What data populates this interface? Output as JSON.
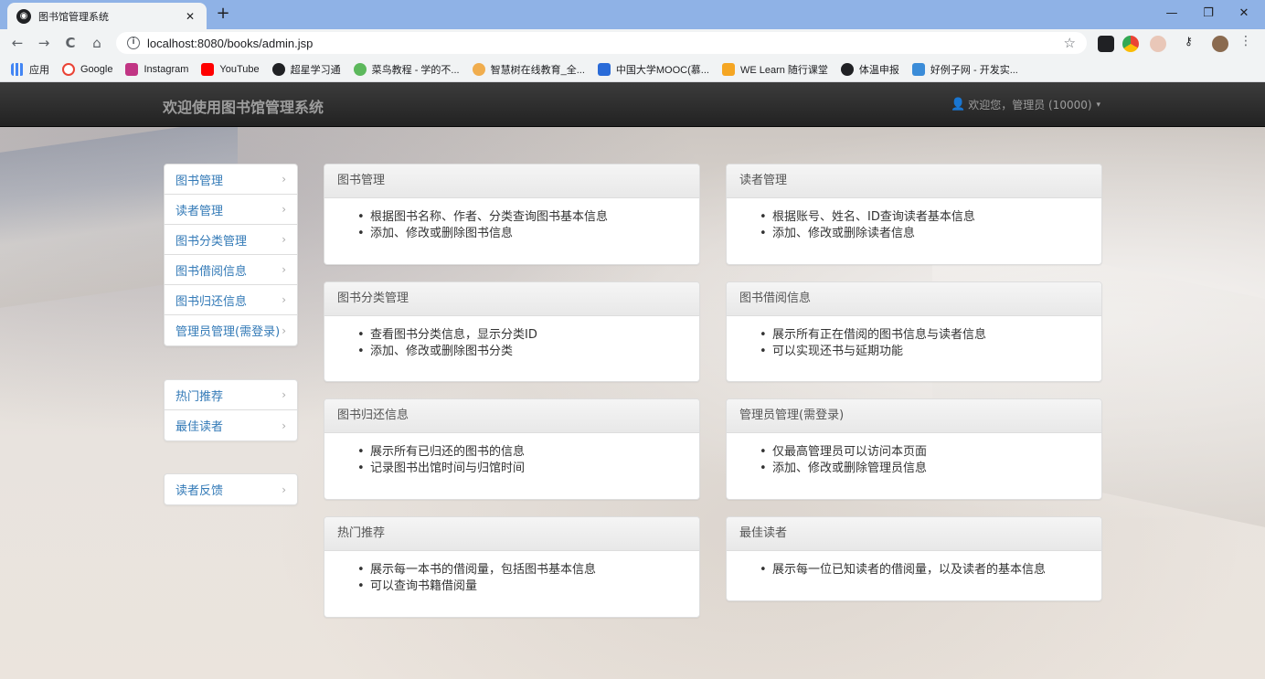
{
  "browser": {
    "tab_title": "图书馆管理系统",
    "tab_close": "✕",
    "new_tab": "+",
    "url": "localhost:8080/books/admin.jsp",
    "back": "←",
    "forward": "→",
    "reload": "C",
    "home": "⌂",
    "star": "☆",
    "window": {
      "minimize": "—",
      "maximize": "❐",
      "close": "✕"
    },
    "bookmarks": [
      {
        "label": "应用",
        "color": "#4285f4"
      },
      {
        "label": "Google",
        "color": "#ea4335"
      },
      {
        "label": "Instagram",
        "color": "#c13584"
      },
      {
        "label": "YouTube",
        "color": "#ff0000"
      },
      {
        "label": "超星学习通",
        "color": "#202124"
      },
      {
        "label": "菜鸟教程 - 学的不...",
        "color": "#5cb85c"
      },
      {
        "label": "智慧树在线教育_全...",
        "color": "#f0ad4e"
      },
      {
        "label": "中国大学MOOC(慕...",
        "color": "#2a6bd8"
      },
      {
        "label": "WE Learn 随行课堂",
        "color": "#f5a623"
      },
      {
        "label": "体温申报",
        "color": "#202124"
      },
      {
        "label": "好例子网 - 开发实...",
        "color": "#3b8cd8"
      }
    ]
  },
  "app": {
    "brand": "欢迎使用图书馆管理系统",
    "user": "欢迎您，管理员 (10000)",
    "user_icon": "👤",
    "caret": "▾"
  },
  "sidebar": {
    "chevron": "›",
    "group1": [
      "图书管理",
      "读者管理",
      "图书分类管理",
      "图书借阅信息",
      "图书归还信息",
      "管理员管理(需登录)"
    ],
    "group2": [
      "热门推荐",
      "最佳读者"
    ],
    "group3": [
      "读者反馈"
    ]
  },
  "panels": [
    {
      "title": "图书管理",
      "items": [
        "根据图书名称、作者、分类查询图书基本信息",
        "添加、修改或删除图书信息"
      ]
    },
    {
      "title": "读者管理",
      "items": [
        "根据账号、姓名、ID查询读者基本信息",
        "添加、修改或删除读者信息"
      ]
    },
    {
      "title": "图书分类管理",
      "items": [
        "查看图书分类信息，显示分类ID",
        "添加、修改或删除图书分类"
      ]
    },
    {
      "title": "图书借阅信息",
      "items": [
        "展示所有正在借阅的图书信息与读者信息",
        "可以实现还书与延期功能"
      ]
    },
    {
      "title": "图书归还信息",
      "items": [
        "展示所有已归还的图书的信息",
        "记录图书出馆时间与归馆时间"
      ]
    },
    {
      "title": "管理员管理(需登录)",
      "items": [
        "仅最高管理员可以访问本页面",
        "添加、修改或删除管理员信息"
      ]
    },
    {
      "title": "热门推荐",
      "items": [
        "展示每一本书的借阅量，包括图书基本信息",
        "可以查询书籍借阅量"
      ]
    },
    {
      "title": "最佳读者",
      "items": [
        "展示每一位已知读者的借阅量，以及读者的基本信息"
      ]
    }
  ]
}
